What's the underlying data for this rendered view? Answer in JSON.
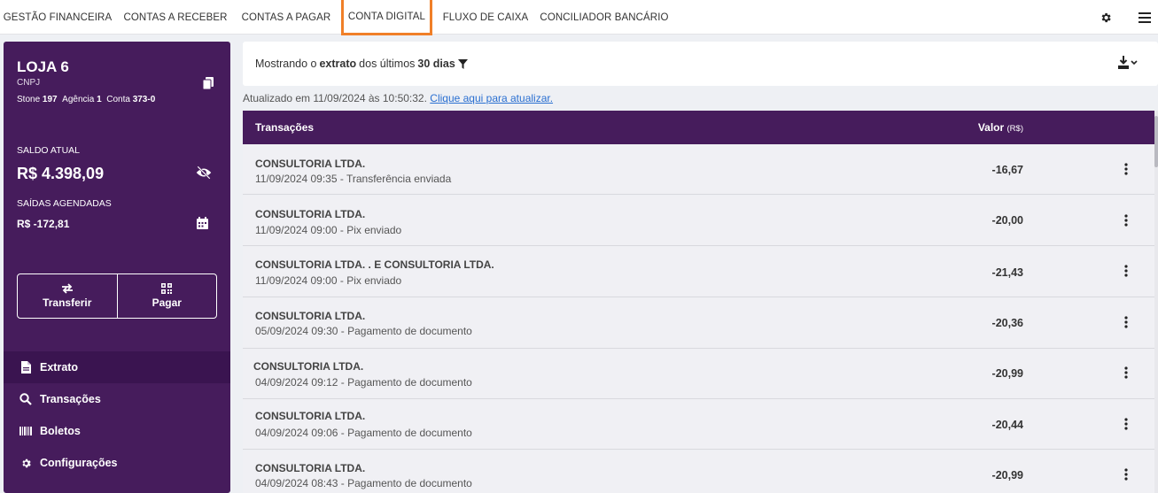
{
  "nav": {
    "tabs": [
      "GESTÃO FINANCEIRA",
      "CONTAS A RECEBER",
      "CONTAS A PAGAR",
      "CONTA DIGITAL",
      "FLUXO DE CAIXA",
      "CONCILIADOR BANCÁRIO"
    ],
    "active_tab": "CONTA DIGITAL",
    "icons": [
      "gear-icon",
      "hamburger-menu-icon"
    ]
  },
  "account": {
    "store_name": "LOJA 6",
    "cnpj_label": "CNPJ",
    "bank_label": "Stone",
    "bank_code": "197",
    "agency_label": "Agência",
    "agency": "1",
    "account_label": "Conta",
    "account": "373-0"
  },
  "balance": {
    "label": "SALDO ATUAL",
    "value": "R$ 4.398,09",
    "scheduled_label": "SAÍDAS AGENDADAS",
    "scheduled_value": "R$ -172,81"
  },
  "actions": {
    "transfer": "Transferir",
    "pay": "Pagar"
  },
  "menu": [
    {
      "label": "Extrato",
      "icon": "document-icon",
      "active": true
    },
    {
      "label": "Transações",
      "icon": "search-icon",
      "active": false
    },
    {
      "label": "Boletos",
      "icon": "barcode-icon",
      "active": false
    },
    {
      "label": "Configurações",
      "icon": "gear-icon",
      "active": false
    }
  ],
  "filter": {
    "prefix": "Mostrando o",
    "bold1": "extrato",
    "middle": "dos últimos",
    "bold2": "30 dias"
  },
  "updated": {
    "text": "Atualizado em 11/09/2024 às 10:50:32.",
    "link": "Clique aqui para atualizar."
  },
  "table": {
    "col_transactions": "Transações",
    "col_value": "Valor",
    "col_value_unit": "(R$)",
    "rows": [
      {
        "name": "CONSULTORIA LTDA.",
        "sub": "11/09/2024 09:35 - Transferência enviada",
        "value": "-16,67"
      },
      {
        "name": "CONSULTORIA LTDA.",
        "sub": "11/09/2024 09:00 - Pix enviado",
        "value": "-20,00"
      },
      {
        "name": "CONSULTORIA LTDA. . E CONSULTORIA LTDA.",
        "sub": "11/09/2024 09:00 - Pix enviado",
        "value": "-21,43"
      },
      {
        "name": "CONSULTORIA LTDA.",
        "sub": "05/09/2024 09:30 - Pagamento de documento",
        "value": "-20,36"
      },
      {
        "name": "CONSULTORIA LTDA.",
        "sub": "04/09/2024 09:12 - Pagamento de documento",
        "value": "-20,99"
      },
      {
        "name": "CONSULTORIA LTDA.",
        "sub": "04/09/2024 09:06 - Pagamento de documento",
        "value": "-20,44"
      },
      {
        "name": "CONSULTORIA LTDA.",
        "sub": "04/09/2024 08:43 - Pagamento de documento",
        "value": "-20,99"
      }
    ]
  },
  "colors": {
    "purple": "#461c5c",
    "accent_orange": "#f07f28",
    "link_blue": "#2a6fd1"
  }
}
